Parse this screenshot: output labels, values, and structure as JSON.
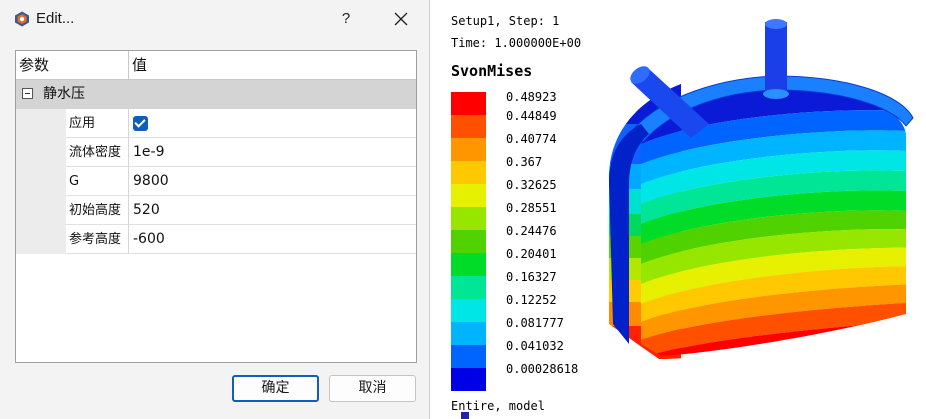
{
  "dialog": {
    "title": "Edit...",
    "help_label": "?",
    "columns": {
      "param": "参数",
      "value": "值"
    },
    "category": "静水压",
    "properties": [
      {
        "name": "应用",
        "value": "",
        "checked": true
      },
      {
        "name": "流体密度",
        "value": "1e-9"
      },
      {
        "name": "G",
        "value": "9800"
      },
      {
        "name": "初始高度",
        "value": "520"
      },
      {
        "name": "参考高度",
        "value": "-600"
      }
    ],
    "ok_label": "确定",
    "cancel_label": "取消"
  },
  "viewport": {
    "setup_line": "Setup1, Step: 1",
    "time_line": "Time: 1.000000E+00",
    "legend_title": "SvonMises",
    "legend": [
      {
        "value": "0.48923",
        "color": "#ff0000"
      },
      {
        "value": "0.44849",
        "color": "#ff5000"
      },
      {
        "value": "0.40774",
        "color": "#ff9600"
      },
      {
        "value": "0.367",
        "color": "#ffc800"
      },
      {
        "value": "0.32625",
        "color": "#e6f000"
      },
      {
        "value": "0.28551",
        "color": "#96e600"
      },
      {
        "value": "0.24476",
        "color": "#50d200"
      },
      {
        "value": "0.20401",
        "color": "#00dc28"
      },
      {
        "value": "0.16327",
        "color": "#00e696"
      },
      {
        "value": "0.12252",
        "color": "#00e6e6"
      },
      {
        "value": "0.081777",
        "color": "#00b4ff"
      },
      {
        "value": "0.041032",
        "color": "#0064ff"
      },
      {
        "value": "0.00028618",
        "color": "#0000e6"
      }
    ],
    "footer": "Entire, model",
    "accent": "#0f5fb8"
  }
}
